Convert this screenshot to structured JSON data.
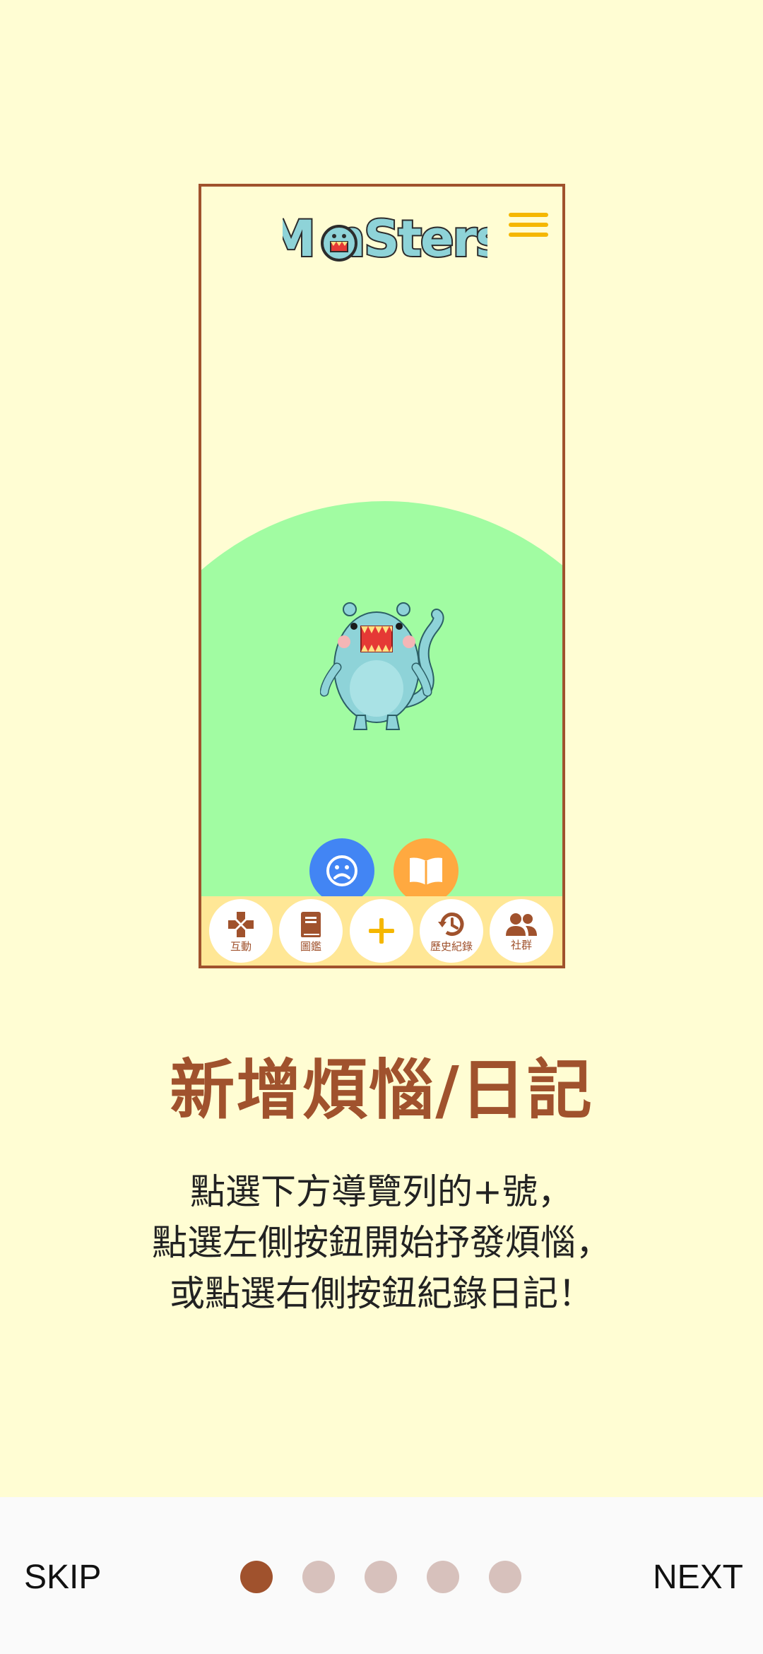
{
  "preview": {
    "logo": "Monsters",
    "menu_icon": "hamburger-menu-icon",
    "fab_worry_icon": "sad-face-icon",
    "fab_diary_icon": "open-book-icon",
    "nav": [
      {
        "label": "互動",
        "icon": "gamepad-icon"
      },
      {
        "label": "圖鑑",
        "icon": "book-icon"
      },
      {
        "label": "",
        "icon": "plus-icon"
      },
      {
        "label": "歷史紀錄",
        "icon": "history-icon"
      },
      {
        "label": "社群",
        "icon": "people-icon"
      }
    ]
  },
  "title": "新增煩惱/日記",
  "description": [
    "點選下方導覽列的+號，",
    "點選左側按鈕開始抒發煩惱，",
    "或點選右側按鈕紀錄日記！"
  ],
  "bottom": {
    "skip_label": "SKIP",
    "next_label": "NEXT",
    "page_count": 5,
    "current_page": 1
  },
  "colors": {
    "background": "#FFFDD3",
    "accent": "#A0522D",
    "hill": "#A1FCA2",
    "navbar": "#FFE796",
    "fab_worry": "#4285F4",
    "fab_diary": "#FFA940",
    "dot_inactive": "#D7C1BC"
  }
}
